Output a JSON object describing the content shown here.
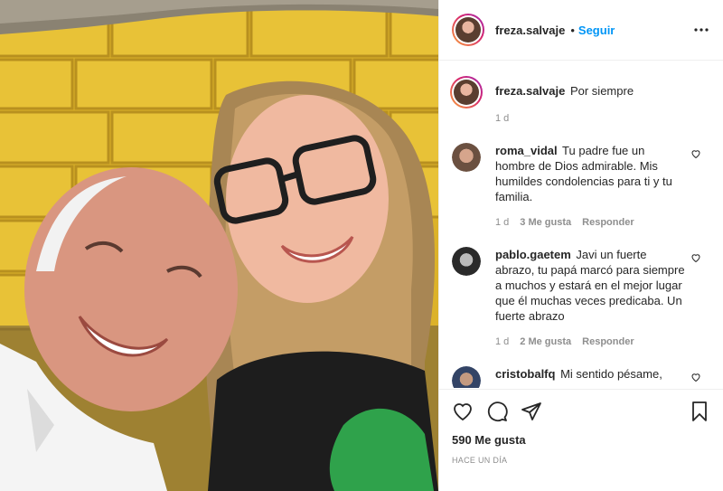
{
  "header": {
    "username": "freza.salvaje",
    "separator": "•",
    "follow_label": "Seguir",
    "more_icon": "more-horizontal-icon"
  },
  "caption": {
    "username": "freza.salvaje",
    "text": "Por siempre",
    "time": "1 d"
  },
  "comments": [
    {
      "username": "roma_vidal",
      "text": "Tu padre fue un hombre de Dios admirable. Mis humildes condolencias para ti y tu familia.",
      "time": "1 d",
      "likes": "3 Me gusta",
      "reply": "Responder"
    },
    {
      "username": "pablo.gaetem",
      "text": "Javi un fuerte abrazo, tu papá marcó para siempre a muchos y estará en el mejor lugar que él muchas veces predicaba. Un fuerte abrazo",
      "time": "1 d",
      "likes": "2 Me gusta",
      "reply": "Responder"
    },
    {
      "username": "cristobalfq",
      "text": "Mi sentido pésame,",
      "time": "",
      "likes": "",
      "reply": ""
    }
  ],
  "actions": {
    "likes": "590 Me gusta",
    "timestamp": "HACE UN DÍA"
  },
  "colors": {
    "accent": "#0095f6",
    "wall": "#e2b92c",
    "muted": "#8e8e8e"
  }
}
